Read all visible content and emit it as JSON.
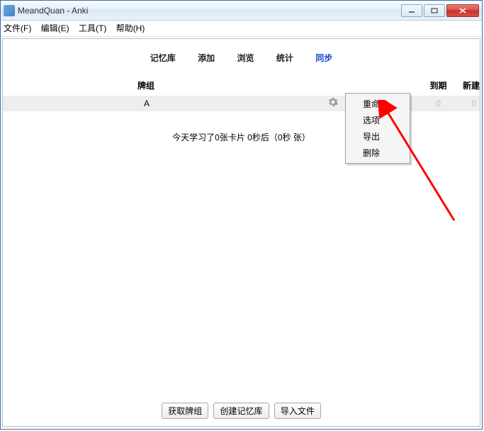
{
  "window": {
    "title": "MeandQuan - Anki"
  },
  "menubar": {
    "file": "文件(F)",
    "edit": "编辑(E)",
    "tools": "工具(T)",
    "help": "帮助(H)"
  },
  "toplinks": {
    "decks": "记忆库",
    "add": "添加",
    "browse": "浏览",
    "stats": "统计",
    "sync": "同步"
  },
  "headers": {
    "deck": "牌组",
    "due": "到期",
    "new": "新建"
  },
  "deck_row": {
    "name": "A",
    "due": "0",
    "new": "0"
  },
  "study_line": "今天学习了0张卡片 0秒后（0秒 张）",
  "bottom": {
    "get": "获取牌组",
    "create": "创建记忆库",
    "import": "导入文件"
  },
  "context_menu": {
    "rename": "重命名",
    "options": "选项",
    "export": "导出",
    "delete": "删除"
  }
}
